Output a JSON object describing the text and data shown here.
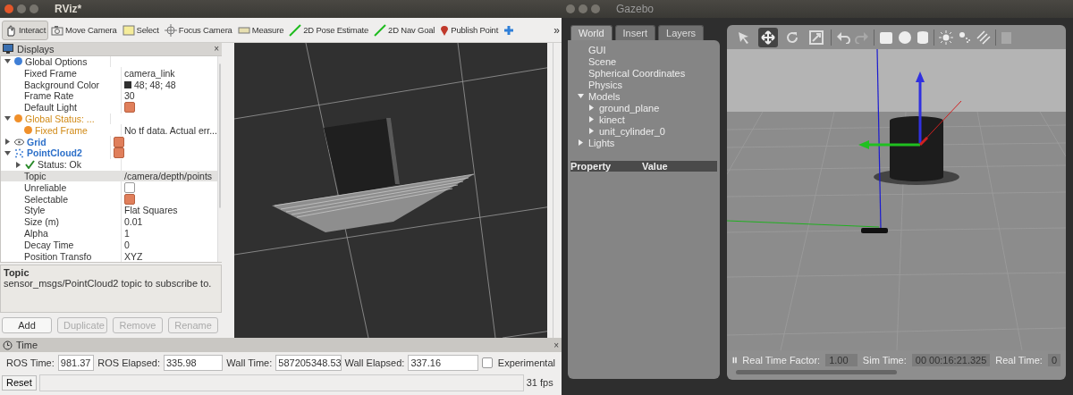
{
  "rviz": {
    "window": {
      "title": "RViz*"
    },
    "tools": [
      {
        "kind": "interact",
        "label": "Interact",
        "selected": true
      },
      {
        "kind": "move",
        "label": "Move Camera",
        "selected": false
      },
      {
        "kind": "select",
        "label": "Select",
        "selected": false
      },
      {
        "kind": "focus",
        "label": "Focus Camera",
        "selected": false
      },
      {
        "kind": "measure",
        "label": "Measure",
        "selected": false
      },
      {
        "kind": "pose",
        "label": "2D Pose Estimate",
        "selected": false
      },
      {
        "kind": "nav",
        "label": "2D Nav Goal",
        "selected": false
      },
      {
        "kind": "point",
        "label": "Publish Point",
        "selected": false
      },
      {
        "kind": "add",
        "selected": false
      }
    ],
    "toolbar_overflow": "»",
    "displays": {
      "title": "Displays",
      "close": "×",
      "items": [
        {
          "kind": "group",
          "label": "Global Options",
          "expanded": true,
          "selected": false,
          "children": [
            {
              "kind": "property",
              "label": "Fixed Frame",
              "value": "camera_link",
              "selected": false
            },
            {
              "kind": "property",
              "label": "Background Color",
              "value": "48; 48; 48",
              "swatch": true,
              "selected": false
            },
            {
              "kind": "property",
              "label": "Frame Rate",
              "value": "30",
              "selected": false
            },
            {
              "kind": "property",
              "label": "Default Light",
              "checked": true,
              "selected": false
            }
          ]
        },
        {
          "kind": "warning",
          "label": "Global Status: ...",
          "expanded": true,
          "selected": false,
          "children": [
            {
              "kind": "warning",
              "label": "Fixed Frame",
              "value": "No tf data.  Actual err...",
              "selected": false
            }
          ]
        },
        {
          "kind": "grid",
          "label": "Grid",
          "expanded": false,
          "checked": true,
          "selected": false
        },
        {
          "kind": "cloud",
          "label": "PointCloud2",
          "expanded": true,
          "checked": true,
          "selected": false,
          "children": [
            {
              "kind": "ok",
              "label": "Status: Ok",
              "expanded": false,
              "selected": false
            },
            {
              "kind": "property",
              "label": "Topic",
              "value": "/camera/depth/points",
              "selected": true
            },
            {
              "kind": "property",
              "label": "Unreliable",
              "checked": false,
              "selected": false
            },
            {
              "kind": "property",
              "label": "Selectable",
              "checked": true,
              "selected": false
            },
            {
              "kind": "property",
              "label": "Style",
              "value": "Flat Squares",
              "selected": false
            },
            {
              "kind": "property",
              "label": "Size (m)",
              "value": "0.01",
              "selected": false
            },
            {
              "kind": "property",
              "label": "Alpha",
              "value": "1",
              "selected": false
            },
            {
              "kind": "property",
              "label": "Decay Time",
              "value": "0",
              "selected": false
            },
            {
              "kind": "property",
              "label": "Position Transfo",
              "value": "XYZ",
              "selected": false
            }
          ]
        }
      ]
    },
    "description": {
      "title": "Topic",
      "text": "sensor_msgs/PointCloud2 topic to subscribe to."
    },
    "buttons": [
      {
        "label": "Add",
        "disabled": false
      },
      {
        "label": "Duplicate",
        "disabled": true
      },
      {
        "label": "Remove",
        "disabled": true
      },
      {
        "label": "Rename",
        "disabled": true
      }
    ],
    "time": {
      "title": "Time",
      "close": "×",
      "fields": [
        {
          "label": "ROS Time:",
          "value": "981.37"
        },
        {
          "label": "ROS Elapsed:",
          "value": "335.98"
        },
        {
          "label": "Wall Time:",
          "value": "587205348.53"
        },
        {
          "label": "Wall Elapsed:",
          "value": "337.16"
        }
      ],
      "experimental": {
        "label": "Experimental",
        "checked": false
      }
    },
    "reset": "Reset",
    "fps": "31 fps"
  },
  "gazebo": {
    "window": {
      "title": "Gazebo"
    },
    "tabs": [
      {
        "label": "World",
        "selected": true
      },
      {
        "label": "Insert",
        "selected": false
      },
      {
        "label": "Layers",
        "selected": false
      }
    ],
    "tree": [
      {
        "label": "GUI"
      },
      {
        "label": "Scene"
      },
      {
        "label": "Spherical Coordinates"
      },
      {
        "label": "Physics"
      },
      {
        "label": "Models",
        "expanded": true,
        "children": [
          {
            "label": "ground_plane",
            "expanded": false
          },
          {
            "label": "kinect",
            "expanded": false
          },
          {
            "label": "unit_cylinder_0",
            "expanded": false
          }
        ]
      },
      {
        "label": "Lights",
        "expanded": false
      }
    ],
    "columns": [
      "Property",
      "Value"
    ],
    "tools": [
      {
        "kind": "select",
        "selected": false
      },
      {
        "kind": "translate",
        "selected": true
      },
      {
        "kind": "rotate",
        "selected": false
      },
      {
        "kind": "scale",
        "selected": false
      }
    ],
    "footer": {
      "rtf_label": "Real Time Factor:",
      "rtf": "1.00",
      "sim_label": "Sim Time:",
      "sim": "00 00:16:21.325",
      "real_label": "Real Time:",
      "real": "0"
    }
  }
}
